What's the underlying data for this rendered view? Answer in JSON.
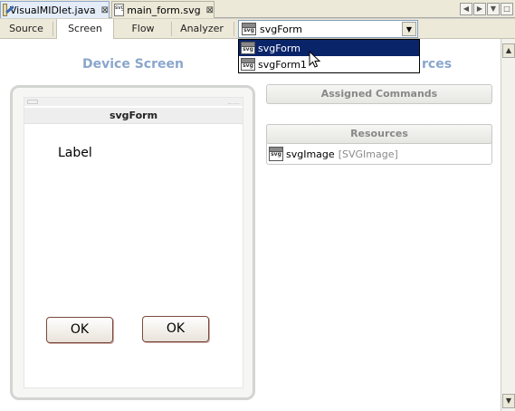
{
  "file_tabs": [
    {
      "label": "VisualMIDlet.java",
      "close": "⊠",
      "active": true
    },
    {
      "label": "main_form.svg",
      "close": "⊠",
      "active": false
    }
  ],
  "view_tabs": [
    "Source",
    "Screen",
    "Flow",
    "Analyzer"
  ],
  "active_view": "Screen",
  "combo": {
    "value": "svgForm"
  },
  "dropdown": {
    "items": [
      "svgForm",
      "svgForm1"
    ],
    "selected": "svgForm"
  },
  "icons": {
    "svg_badge": "svg"
  },
  "device_panel": {
    "heading": "Device Screen",
    "form_title": "svgForm",
    "label": "Label",
    "buttons": [
      "OK",
      "OK"
    ]
  },
  "right_panel": {
    "heading_partial": "rces",
    "assigned_commands": "Assigned Commands",
    "resources_title": "Resources",
    "resource_name": "svgImage",
    "resource_type": "[SVGImage]"
  },
  "colors": {
    "heading": "#8aa6cd",
    "selection": "#0a246a"
  }
}
